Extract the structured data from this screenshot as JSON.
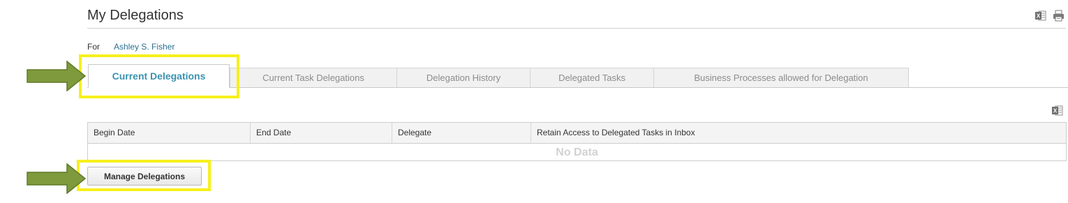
{
  "header": {
    "title": "My Delegations",
    "export_icon": "excel-export-icon",
    "print_icon": "print-icon"
  },
  "for_line": {
    "label": "For",
    "user": "Ashley S. Fisher"
  },
  "tabs": [
    {
      "label": "Current Delegations",
      "active": true
    },
    {
      "label": "Current Task Delegations",
      "active": false
    },
    {
      "label": "Delegation History",
      "active": false
    },
    {
      "label": "Delegated Tasks",
      "active": false
    },
    {
      "label": "Business Processes allowed for Delegation",
      "active": false
    }
  ],
  "table": {
    "export_icon": "excel-export-icon",
    "columns": [
      "Begin Date",
      "End Date",
      "Delegate",
      "Retain Access to Delegated Tasks in Inbox"
    ],
    "empty_text": "No Data"
  },
  "actions": {
    "manage_label": "Manage Delegations"
  },
  "annotations": {
    "highlight_color": "#f7f01c",
    "arrow_color": "#7f9a3c"
  }
}
